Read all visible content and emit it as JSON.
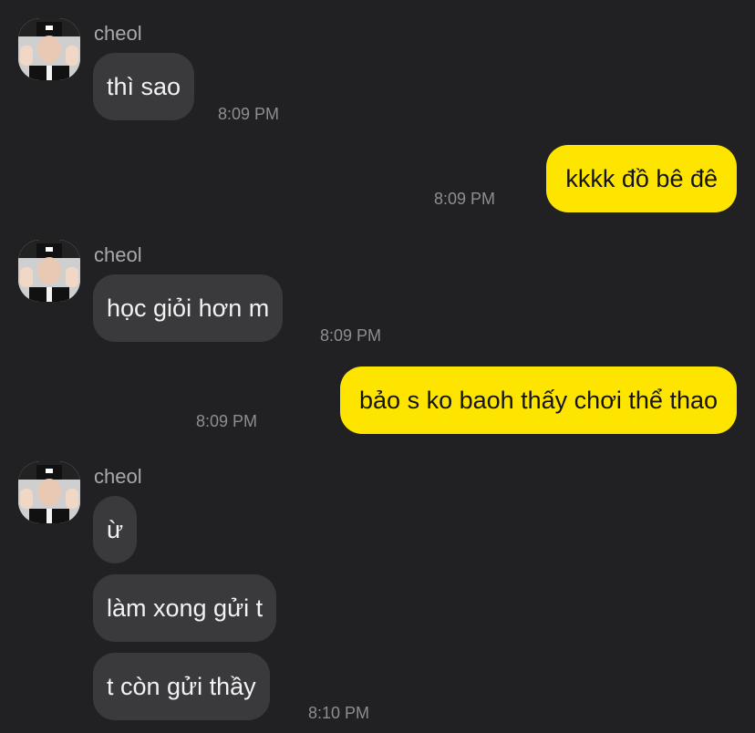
{
  "messages": [
    {
      "sender": "cheol",
      "text": "thì sao",
      "time": "8:09 PM"
    },
    {
      "text": "kkkk đồ bê đê",
      "time": "8:09 PM"
    },
    {
      "sender": "cheol",
      "text": "học giỏi hơn m",
      "time": "8:09 PM"
    },
    {
      "text": "bảo s ko baoh thấy chơi thể thao",
      "time": "8:09 PM"
    },
    {
      "sender": "cheol",
      "text": "ừ"
    },
    {
      "text": "làm xong gửi t"
    },
    {
      "text": "t còn gửi thầy",
      "time": "8:10 PM"
    }
  ]
}
